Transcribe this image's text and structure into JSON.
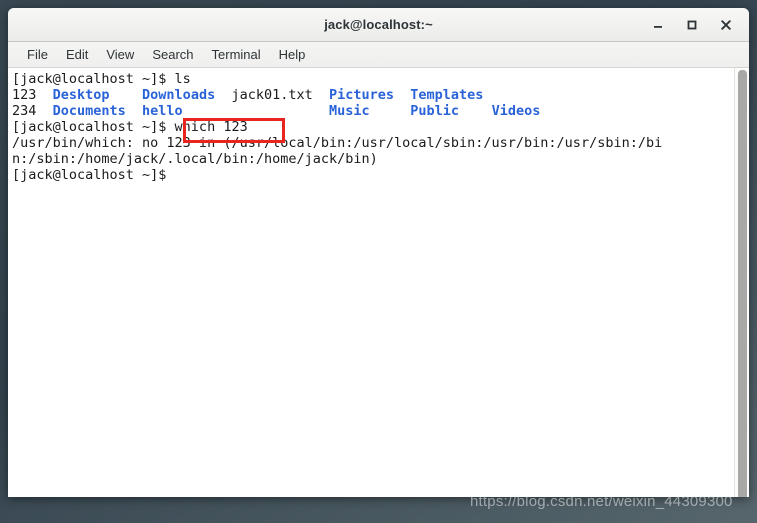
{
  "window": {
    "title": "jack@localhost:~",
    "buttons": {
      "minimize": "minimize-button",
      "maximize": "maximize-button",
      "close": "close-button"
    }
  },
  "menubar": {
    "items": [
      {
        "label": "File"
      },
      {
        "label": "Edit"
      },
      {
        "label": "View"
      },
      {
        "label": "Search"
      },
      {
        "label": "Terminal"
      },
      {
        "label": "Help"
      }
    ]
  },
  "terminal": {
    "prompt": "[jack@localhost ~]$",
    "lines": [
      {
        "id": "line-prompt-ls",
        "segments": [
          {
            "text": "[jack@localhost ~]$ ls",
            "style": "plain"
          }
        ]
      },
      {
        "id": "line-ls-row1",
        "segments": [
          {
            "text": "123  ",
            "style": "plain"
          },
          {
            "text": "Desktop    ",
            "style": "dirname"
          },
          {
            "text": "Downloads  ",
            "style": "dirname"
          },
          {
            "text": "jack01.txt  ",
            "style": "plain"
          },
          {
            "text": "Pictures  ",
            "style": "dirname"
          },
          {
            "text": "Templates",
            "style": "dirname"
          }
        ]
      },
      {
        "id": "line-ls-row2",
        "segments": [
          {
            "text": "234  ",
            "style": "plain"
          },
          {
            "text": "Documents  ",
            "style": "dirname"
          },
          {
            "text": "hello      ",
            "style": "dirname"
          },
          {
            "text": "            ",
            "style": "plain"
          },
          {
            "text": "Music     ",
            "style": "dirname"
          },
          {
            "text": "Public    ",
            "style": "dirname"
          },
          {
            "text": "Videos",
            "style": "dirname"
          }
        ]
      },
      {
        "id": "line-prompt-which",
        "segments": [
          {
            "text": "[jack@localhost ~]$ which 123",
            "style": "plain"
          }
        ]
      },
      {
        "id": "line-which-output-1",
        "segments": [
          {
            "text": "/usr/bin/which: no 123 in (/usr/local/bin:/usr/local/sbin:/usr/bin:/usr/sbin:/bi",
            "style": "plain"
          }
        ]
      },
      {
        "id": "line-which-output-2",
        "segments": [
          {
            "text": "n:/sbin:/home/jack/.local/bin:/home/jack/bin)",
            "style": "plain"
          }
        ]
      },
      {
        "id": "line-prompt-final",
        "segments": [
          {
            "text": "[jack@localhost ~]$",
            "style": "plain"
          }
        ]
      }
    ]
  },
  "annotation": {
    "label": "which-123-highlight",
    "color": "#e8251f"
  },
  "watermark": {
    "text": "https://blog.csdn.net/weixin_44309300"
  },
  "colors": {
    "directory_blue": "#2a63d8",
    "text_black": "#1b1b1b",
    "terminal_bg": "#ffffff",
    "titlebar_bg": "#f1f1f0",
    "annotation_red": "#e8251f"
  }
}
